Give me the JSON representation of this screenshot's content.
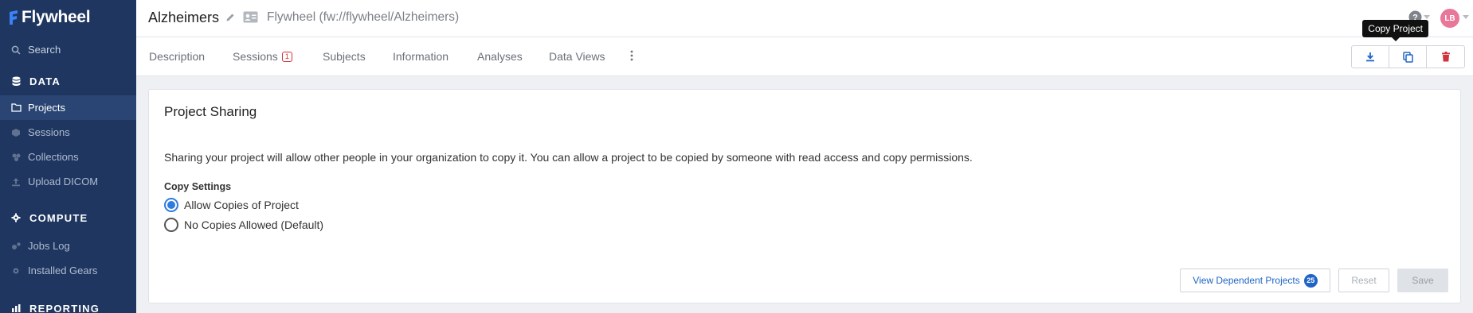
{
  "app": {
    "name": "Flywheel"
  },
  "sidebar": {
    "search_label": "Search",
    "sections": {
      "data": "DATA",
      "compute": "COMPUTE",
      "reporting": "REPORTING"
    },
    "data_items": [
      "Projects",
      "Sessions",
      "Collections",
      "Upload DICOM"
    ],
    "compute_items": [
      "Jobs Log",
      "Installed Gears"
    ],
    "active_item": "Projects"
  },
  "header": {
    "title": "Alzheimers",
    "path": "Flywheel (fw://flywheel/Alzheimers)",
    "avatar_initials": "LB"
  },
  "tabs": {
    "items": [
      {
        "label": "Description"
      },
      {
        "label": "Sessions",
        "badge": "1"
      },
      {
        "label": "Subjects"
      },
      {
        "label": "Information"
      },
      {
        "label": "Analyses"
      },
      {
        "label": "Data Views"
      }
    ],
    "tooltip": "Copy Project"
  },
  "card": {
    "title": "Project Sharing",
    "description": "Sharing your project will allow other people in your organization to copy it. You can allow a project to be copied by someone with read access and copy permissions.",
    "settings_label": "Copy Settings",
    "options": [
      {
        "label": "Allow Copies of Project",
        "selected": true
      },
      {
        "label": "No Copies Allowed (Default)",
        "selected": false
      }
    ],
    "dependent_button": "View Dependent Projects",
    "dependent_count": "25",
    "reset_button": "Reset",
    "save_button": "Save"
  },
  "colors": {
    "sidebar_bg": "#1e3660",
    "accent": "#2f7be0",
    "danger": "#d2323a",
    "avatar": "#e8779a"
  },
  "icons": [
    "flywheel-logo-icon",
    "search-icon",
    "database-icon",
    "folder-icon",
    "cube-icon",
    "collections-icon",
    "upload-icon",
    "gear-icon",
    "jobs-icon",
    "pencil-icon",
    "id-card-icon",
    "help-icon",
    "download-icon",
    "copy-icon",
    "trash-icon",
    "kebab-icon"
  ]
}
